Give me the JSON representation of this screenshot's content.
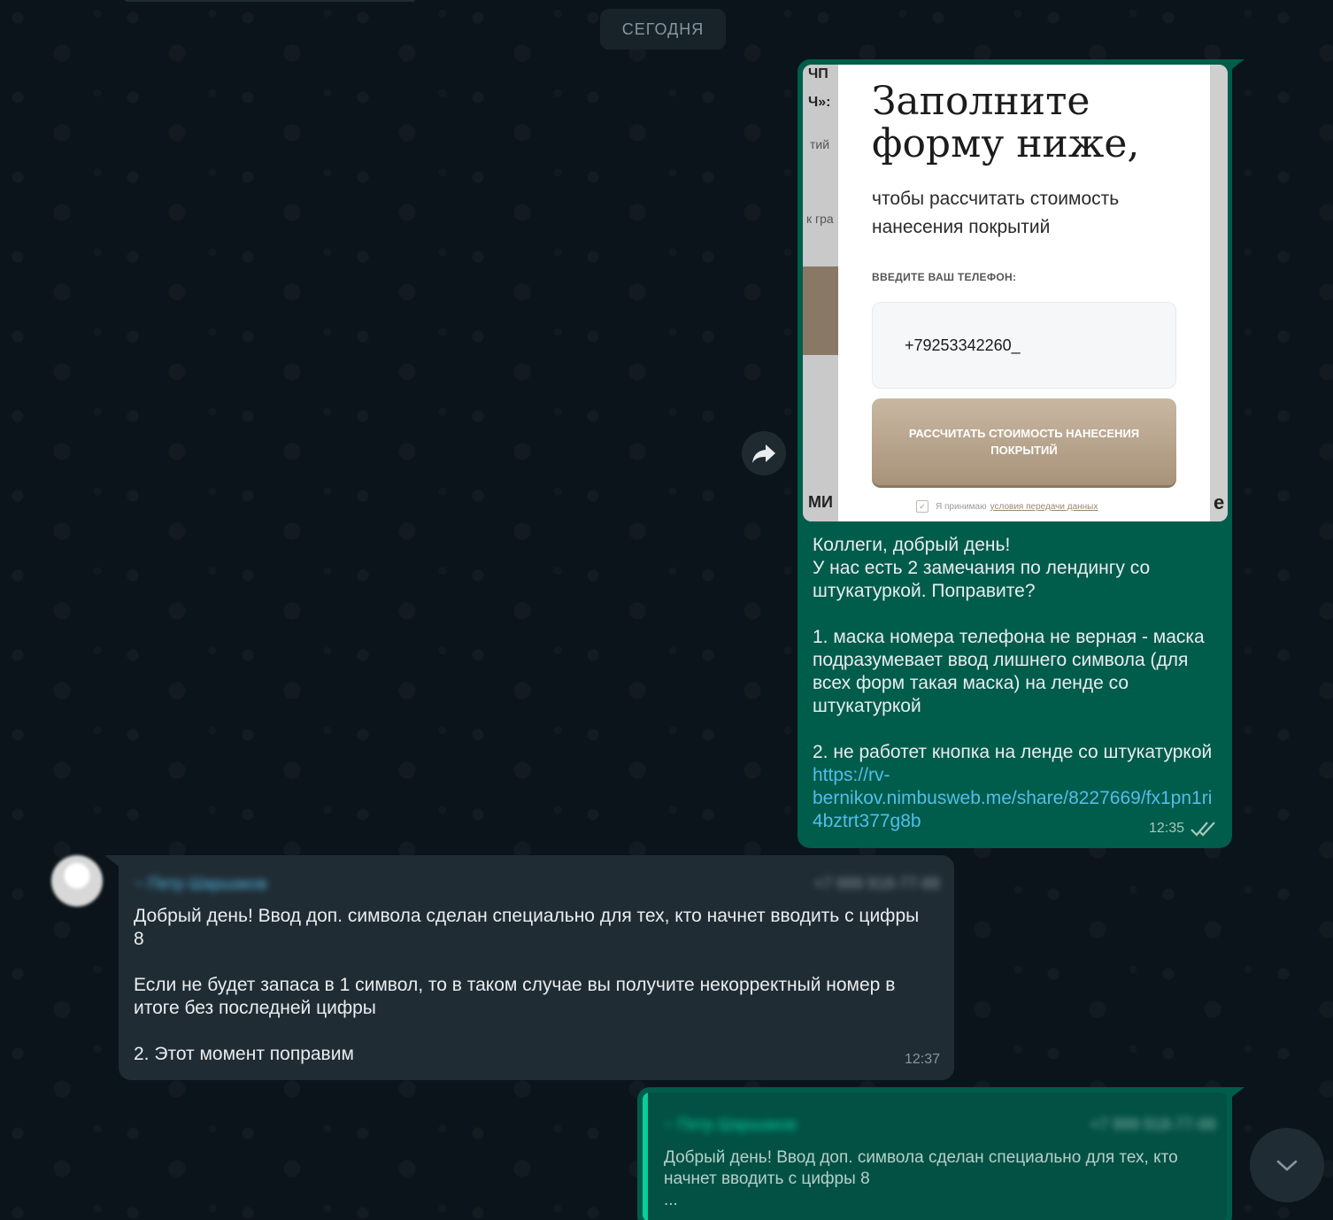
{
  "date_separator": "СЕГОДНЯ",
  "outgoing_message": {
    "screenshot": {
      "title": "Заполните форму ниже,",
      "subtitle": "чтобы рассчитать стоимость нанесения покрытий",
      "phone_label": "ВВЕДИТЕ ВАШ ТЕЛЕФОН:",
      "phone_value": "+79253342260_",
      "button_label": "РАССЧИТАТЬ СТОИМОСТЬ НАНЕСЕНИЯ ПОКРЫТИЙ",
      "consent_text": "Я принимаю",
      "consent_link": "условия передачи данных",
      "left_fragments": [
        "ЧП",
        "Ч»:",
        "тий",
        "к гра",
        "МИ"
      ],
      "right_fragment": "е"
    },
    "text": "Коллеги, добрый день!\nУ нас есть 2 замечания по лендингу со штукатуркой. Поправите?\n\n1. маска номера телефона не верная - маска подразумевает ввод лишнего символа (для всех форм такая маска) на ленде со штукатуркой\n\n2. не работет кнопка на ленде со штукатуркой ",
    "link": "https://rv-bernikov.nimbusweb.me/share/8227669/fx1pn1ri4bztrt377g8b",
    "time": "12:35",
    "status_icon": "double-check-icon"
  },
  "incoming_message": {
    "sender": "~ Петр Шаршаков",
    "phone": "+7 999 918-77-88",
    "text": "Добрый день! Ввод доп. символа сделан специально для тех, кто начнет вводить с цифры 8\n\nЕсли не будет запаса в 1 символ, то в таком случае вы получите некорректный номер в итоге без последней цифры\n\n2. Этот момент поправим",
    "time": "12:37"
  },
  "reply_message": {
    "quote_sender": "~ Петр Шаршаков",
    "quote_phone": "+7 999 918-77-88",
    "quote_text": "Добрый день! Ввод доп. символа сделан специально для тех, кто начнет вводить с цифры 8\n..."
  },
  "icons": {
    "forward": "forward-icon",
    "scroll_down": "chevron-down-icon"
  },
  "colors": {
    "background": "#0b141a",
    "outgoing_bubble": "#005c4b",
    "incoming_bubble": "#202c33",
    "link": "#53bdeb",
    "text": "#e9edef"
  }
}
